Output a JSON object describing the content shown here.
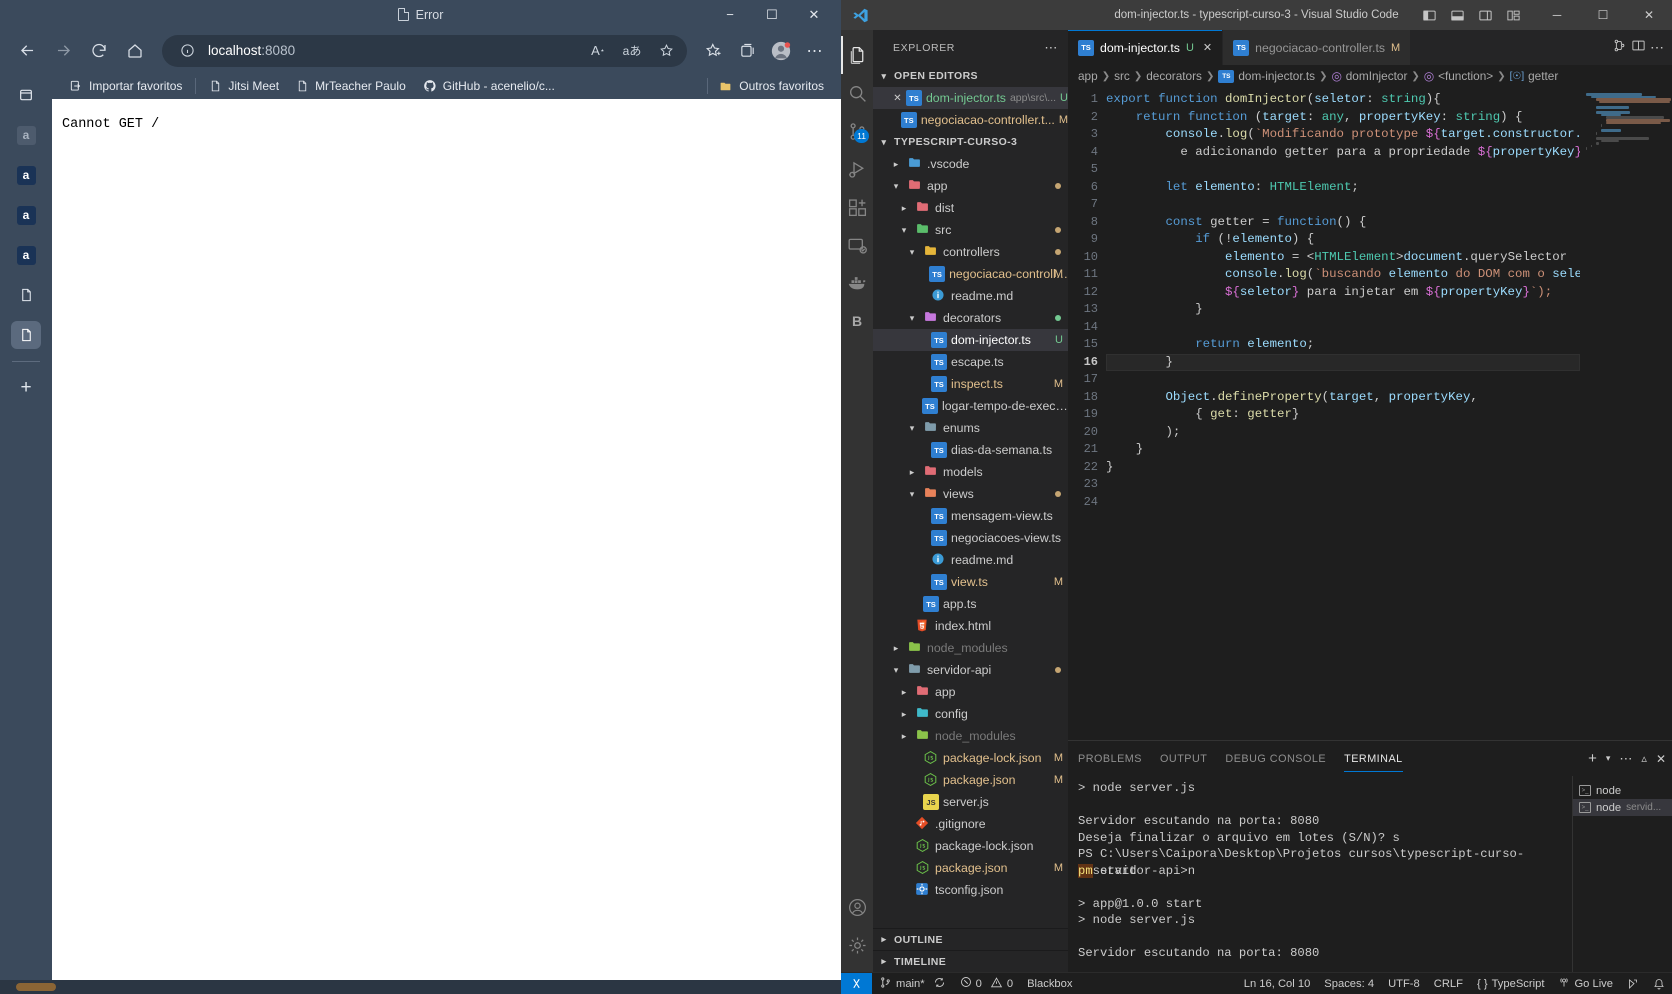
{
  "browser": {
    "window_title": "Error",
    "window_buttons": {
      "minimize": "−",
      "maximize": "☐",
      "close": "✕"
    },
    "nav": {
      "back": "back-arrow",
      "forward": "forward-arrow",
      "refresh": "refresh",
      "home": "home"
    },
    "address": {
      "host": "localhost",
      "rest": ":8080",
      "full": "localhost:8080",
      "info_icon": "info-circle"
    },
    "omnibox_icons": [
      "read-aloud-icon",
      "translate-icon",
      "add-favorite-icon"
    ],
    "toolbar_icons": [
      "favorites-icon",
      "collections-icon",
      "profile-icon",
      "settings-more-icon"
    ],
    "bookmarks": [
      {
        "label": "Importar favoritos",
        "icon": "import-favorites-icon"
      },
      {
        "label": "Jitsi Meet",
        "icon": "page-icon"
      },
      {
        "label": "MrTeacher Paulo",
        "icon": "page-icon"
      },
      {
        "label": "GitHub - acenelio/c...",
        "icon": "github-icon"
      }
    ],
    "bookmarks_right": {
      "label": "Outros favoritos",
      "icon": "folder-icon"
    },
    "vertical_tabs": [
      {
        "icon": "tab-list-icon",
        "active": false
      },
      {
        "icon": "a-tab-icon",
        "active": false,
        "dim": true
      },
      {
        "icon": "a-tab-icon",
        "active": false
      },
      {
        "icon": "a-tab-icon",
        "active": false
      },
      {
        "icon": "a-tab-icon",
        "active": false
      },
      {
        "icon": "page-tab-icon",
        "active": false
      },
      {
        "icon": "page-tab-icon",
        "active": true
      }
    ],
    "new_tab_label": "+",
    "page_text": "Cannot GET /"
  },
  "vscode": {
    "window_title": "dom-injector.ts - typescript-curso-3 - Visual Studio Code",
    "title_layout_icons": [
      "toggle-primary-sidebar-icon",
      "toggle-panel-icon",
      "toggle-secondary-sidebar-icon",
      "customize-layout-icon"
    ],
    "window_buttons": {
      "minimize": "─",
      "maximize": "☐",
      "close": "✕"
    },
    "activitybar": [
      {
        "name": "explorer",
        "icon": "files-icon",
        "active": true,
        "badge": null
      },
      {
        "name": "search",
        "icon": "search-icon",
        "active": false,
        "badge": null
      },
      {
        "name": "source-control",
        "icon": "source-control-icon",
        "active": false,
        "badge": "11"
      },
      {
        "name": "run-and-debug",
        "icon": "run-debug-icon",
        "active": false,
        "badge": null
      },
      {
        "name": "extensions",
        "icon": "extensions-icon",
        "active": false,
        "badge": null
      },
      {
        "name": "remote-explorer",
        "icon": "remote-explorer-icon",
        "active": false,
        "badge": null
      },
      {
        "name": "docker",
        "icon": "docker-icon",
        "active": false,
        "badge": null
      },
      {
        "name": "blackbox",
        "icon": "blackbox-icon",
        "letter": "B",
        "active": false,
        "badge": null
      }
    ],
    "activitybar_bottom": [
      {
        "name": "accounts",
        "icon": "account-icon"
      },
      {
        "name": "manage",
        "icon": "gear-icon"
      }
    ],
    "sidebar": {
      "title": "EXPLORER",
      "more_actions": "⋯",
      "open_editors": {
        "label": "OPEN EDITORS",
        "expanded": true,
        "items": [
          {
            "name": "dom-injector.ts",
            "path": "app\\src\\...",
            "badge": "U",
            "badge_kind": "untracked",
            "active": true,
            "close": "✕",
            "icon": "typescript-icon"
          },
          {
            "name": "negociacao-controller.t...",
            "path": "",
            "badge": "M",
            "badge_kind": "modified",
            "active": false,
            "close": "",
            "icon": "typescript-icon"
          }
        ]
      },
      "project": {
        "label": "TYPESCRIPT-CURSO-3",
        "expanded": true,
        "tree": [
          {
            "depth": 1,
            "name": ".vscode",
            "type": "folder",
            "expanded": false,
            "icon": "folder-vscode-icon",
            "badge": ""
          },
          {
            "depth": 1,
            "name": "app",
            "type": "folder",
            "expanded": true,
            "icon": "folder-app-icon",
            "badge": "",
            "dot": "#c5a572"
          },
          {
            "depth": 2,
            "name": "dist",
            "type": "folder",
            "expanded": false,
            "icon": "folder-dist-icon",
            "badge": ""
          },
          {
            "depth": 2,
            "name": "src",
            "type": "folder",
            "expanded": true,
            "icon": "folder-src-icon",
            "badge": "",
            "dot": "#c5a572"
          },
          {
            "depth": 3,
            "name": "controllers",
            "type": "folder",
            "expanded": true,
            "icon": "folder-controllers-icon",
            "badge": "",
            "dot": "#c5a572"
          },
          {
            "depth": 4,
            "name": "negociacao-controlle...",
            "type": "ts",
            "icon": "typescript-icon",
            "badge": "M",
            "badge_kind": "modified"
          },
          {
            "depth": 4,
            "name": "readme.md",
            "type": "md",
            "icon": "info-icon",
            "badge": ""
          },
          {
            "depth": 3,
            "name": "decorators",
            "type": "folder",
            "expanded": true,
            "icon": "folder-decorators-icon",
            "badge": "",
            "dot": "#73c991"
          },
          {
            "depth": 4,
            "name": "dom-injector.ts",
            "type": "ts",
            "icon": "typescript-icon",
            "badge": "U",
            "badge_kind": "untracked",
            "selected": true
          },
          {
            "depth": 4,
            "name": "escape.ts",
            "type": "ts",
            "icon": "typescript-icon",
            "badge": ""
          },
          {
            "depth": 4,
            "name": "inspect.ts",
            "type": "ts",
            "icon": "typescript-icon",
            "badge": "M",
            "badge_kind": "modified"
          },
          {
            "depth": 4,
            "name": "logar-tempo-de-execucao....",
            "type": "ts",
            "icon": "typescript-icon",
            "badge": ""
          },
          {
            "depth": 3,
            "name": "enums",
            "type": "folder",
            "expanded": true,
            "icon": "folder-enums-icon",
            "badge": ""
          },
          {
            "depth": 4,
            "name": "dias-da-semana.ts",
            "type": "ts",
            "icon": "typescript-icon",
            "badge": ""
          },
          {
            "depth": 3,
            "name": "models",
            "type": "folder",
            "expanded": false,
            "icon": "folder-models-icon",
            "badge": ""
          },
          {
            "depth": 3,
            "name": "views",
            "type": "folder",
            "expanded": true,
            "icon": "folder-views-icon",
            "badge": "",
            "dot": "#c5a572"
          },
          {
            "depth": 4,
            "name": "mensagem-view.ts",
            "type": "ts",
            "icon": "typescript-icon",
            "badge": ""
          },
          {
            "depth": 4,
            "name": "negociacoes-view.ts",
            "type": "ts",
            "icon": "typescript-icon",
            "badge": ""
          },
          {
            "depth": 4,
            "name": "readme.md",
            "type": "md",
            "icon": "info-icon",
            "badge": ""
          },
          {
            "depth": 4,
            "name": "view.ts",
            "type": "ts",
            "icon": "typescript-icon",
            "badge": "M",
            "badge_kind": "modified"
          },
          {
            "depth": 3,
            "name": "app.ts",
            "type": "ts",
            "icon": "typescript-icon",
            "badge": ""
          },
          {
            "depth": 2,
            "name": "index.html",
            "type": "html",
            "icon": "html-icon",
            "badge": ""
          },
          {
            "depth": 1,
            "name": "node_modules",
            "type": "folder",
            "expanded": false,
            "icon": "folder-node-icon",
            "badge": "",
            "dim": true
          },
          {
            "depth": 1,
            "name": "servidor-api",
            "type": "folder",
            "expanded": true,
            "icon": "folder-generic-icon",
            "badge": "",
            "dot": "#c5a572"
          },
          {
            "depth": 2,
            "name": "app",
            "type": "folder",
            "expanded": false,
            "icon": "folder-app-icon",
            "badge": ""
          },
          {
            "depth": 2,
            "name": "config",
            "type": "folder",
            "expanded": false,
            "icon": "folder-config-icon",
            "badge": ""
          },
          {
            "depth": 2,
            "name": "node_modules",
            "type": "folder",
            "expanded": false,
            "icon": "folder-node-icon",
            "badge": "",
            "dim": true
          },
          {
            "depth": 3,
            "name": "package-lock.json",
            "type": "json",
            "icon": "nodejs-icon",
            "badge": "M",
            "badge_kind": "modified"
          },
          {
            "depth": 3,
            "name": "package.json",
            "type": "json",
            "icon": "nodejs-icon",
            "badge": "M",
            "badge_kind": "modified"
          },
          {
            "depth": 3,
            "name": "server.js",
            "type": "js",
            "icon": "javascript-icon",
            "badge": ""
          },
          {
            "depth": 2,
            "name": ".gitignore",
            "type": "git",
            "icon": "git-icon",
            "badge": ""
          },
          {
            "depth": 2,
            "name": "package-lock.json",
            "type": "json",
            "icon": "nodejs-icon",
            "badge": ""
          },
          {
            "depth": 2,
            "name": "package.json",
            "type": "json",
            "icon": "nodejs-icon",
            "badge": "M",
            "badge_kind": "modified"
          },
          {
            "depth": 2,
            "name": "tsconfig.json",
            "type": "json",
            "icon": "tsconfig-icon",
            "badge": ""
          }
        ]
      },
      "footer_sections": [
        {
          "label": "OUTLINE",
          "expanded": false
        },
        {
          "label": "TIMELINE",
          "expanded": false
        }
      ]
    },
    "editor": {
      "tabs": [
        {
          "label": "dom-injector.ts",
          "badge": "U",
          "badge_kind": "untracked",
          "active": true,
          "close": "✕",
          "icon": "typescript-icon"
        },
        {
          "label": "negociacao-controller.ts",
          "badge": "M",
          "badge_kind": "modified",
          "active": false,
          "close": "",
          "icon": "typescript-icon"
        }
      ],
      "tab_actions": [
        "split-editor-icon",
        "more-actions-icon"
      ],
      "breadcrumb": [
        {
          "label": "app",
          "icon": ""
        },
        {
          "label": "src",
          "icon": ""
        },
        {
          "label": "decorators",
          "icon": ""
        },
        {
          "label": "dom-injector.ts",
          "icon": "typescript-icon"
        },
        {
          "label": "domInjector",
          "icon": "symbol-function-icon"
        },
        {
          "label": "<function>",
          "icon": "symbol-function-icon"
        },
        {
          "label": "getter",
          "icon": "symbol-property-icon"
        }
      ],
      "current_line": 16,
      "total_lines": 24,
      "lines": [
        {
          "n": 1,
          "text": "export function domInjector(seletor: string){"
        },
        {
          "n": 2,
          "text": "    return function (target: any, propertyKey: string) {"
        },
        {
          "n": 3,
          "text": "        console.log(`Modificando prototype ${target.constructor.name}"
        },
        {
          "n": 4,
          "text": "          e adicionando getter para a propriedade ${propertyKey}`);"
        },
        {
          "n": 5,
          "text": ""
        },
        {
          "n": 6,
          "text": "        let elemento: HTMLElement;"
        },
        {
          "n": 7,
          "text": ""
        },
        {
          "n": 8,
          "text": "        const getter = function() {"
        },
        {
          "n": 9,
          "text": "            if (!elemento) {"
        },
        {
          "n": 10,
          "text": "                elemento = <HTMLElement>document.querySelector"
        },
        {
          "n": 11,
          "text": "                console.log(`buscando elemento do DOM com o seletor"
        },
        {
          "n": 12,
          "text": "                ${seletor} para injetar em ${propertyKey}`);"
        },
        {
          "n": 13,
          "text": "            }"
        },
        {
          "n": 14,
          "text": ""
        },
        {
          "n": 15,
          "text": "            return elemento;"
        },
        {
          "n": 16,
          "text": "        }"
        },
        {
          "n": 17,
          "text": ""
        },
        {
          "n": 18,
          "text": "        Object.defineProperty(target, propertyKey,"
        },
        {
          "n": 19,
          "text": "            { get: getter}"
        },
        {
          "n": 20,
          "text": "        );"
        },
        {
          "n": 21,
          "text": "    }"
        },
        {
          "n": 22,
          "text": "}"
        },
        {
          "n": 23,
          "text": ""
        },
        {
          "n": 24,
          "text": ""
        }
      ]
    },
    "panel": {
      "tabs": [
        {
          "label": "PROBLEMS",
          "active": false
        },
        {
          "label": "OUTPUT",
          "active": false
        },
        {
          "label": "DEBUG CONSOLE",
          "active": false
        },
        {
          "label": "TERMINAL",
          "active": true
        }
      ],
      "actions": [
        "new-terminal-icon",
        "split-dropdown-icon",
        "more-actions-icon",
        "maximize-panel-icon",
        "close-panel-icon"
      ],
      "terminal_lines": [
        "> node server.js",
        "",
        "Servidor escutando na porta: 8080",
        "Deseja finalizar o arquivo em lotes (S/N)? s",
        "PS C:\\Users\\Caipora\\Desktop\\Projetos cursos\\typescript-curso-3\\servidor-api>n",
        "pm start",
        "",
        "> app@1.0.0 start",
        "> node server.js",
        "",
        "Servidor escutando na porta: 8080",
        ""
      ],
      "terminal_list": [
        {
          "label": "node",
          "sub": "",
          "active": false,
          "icon": "terminal-icon"
        },
        {
          "label": "node",
          "sub": "servid...",
          "active": true,
          "icon": "terminal-icon"
        }
      ]
    },
    "statusbar": {
      "remote_icon": "remote-window-icon",
      "branch": "main*",
      "sync_icon": "sync-icon",
      "errors": "0",
      "warnings": "0",
      "blackbox": "Blackbox",
      "cursor": "Ln 16, Col 10",
      "spaces": "Spaces: 4",
      "encoding": "UTF-8",
      "eol": "CRLF",
      "language": "TypeScript",
      "golive": "Go Live",
      "right_icons": [
        "feedback-icon",
        "bell-icon"
      ]
    }
  },
  "colors": {
    "edge_chrome": "#3b4a5c",
    "vscode_bg": "#1e1e1e",
    "vscode_sidebar": "#252526",
    "accent_blue": "#0078d4",
    "modified": "#e2c08d",
    "untracked": "#73c991",
    "string": "#ce9178",
    "keyword": "#569cd6"
  }
}
